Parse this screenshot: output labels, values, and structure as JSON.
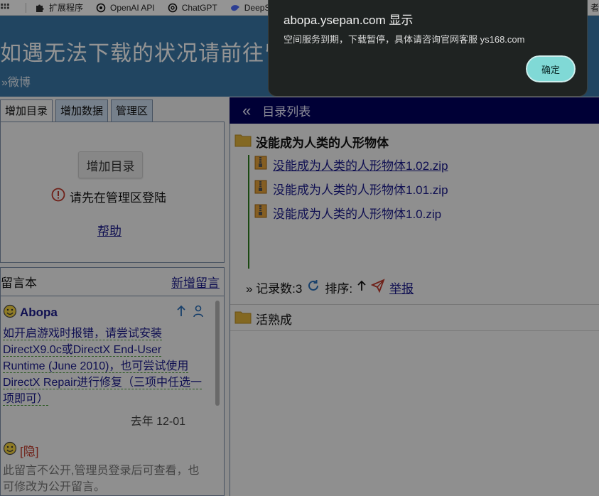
{
  "bookmarks": [
    {
      "label": "扩展程序",
      "icon": "puzzle-icon"
    },
    {
      "label": "OpenAI API",
      "icon": "openai-icon"
    },
    {
      "label": "ChatGPT",
      "icon": "openai-icon"
    },
    {
      "label": "DeepS",
      "icon": "deepseek-icon"
    },
    {
      "label": "者",
      "icon": ""
    }
  ],
  "banner": {
    "title": "如遇无法下载的状况请前往留言本留言，我们会在第一时间",
    "subtitle": "»微博"
  },
  "left_tabs": [
    "增加目录",
    "增加数据",
    "管理区"
  ],
  "add_panel": {
    "button_label": "增加目录",
    "login_tip": "请先在管理区登陆",
    "help_link": "帮助"
  },
  "guestbook": {
    "title": "留言本",
    "new_link": "新增留言",
    "messages": [
      {
        "author": "Abopa",
        "text": "如开启游戏时报错，请尝试安装DirectX9.0c或DirectX End-User Runtime (June 2010)，也可尝试使用DirectX Repair进行修复（三项中任选一项即可）",
        "date": "去年 12-01"
      },
      {
        "author": "[隐]",
        "text": "此留言不公开,管理员登录后可查看，也可修改为公开留言。"
      }
    ]
  },
  "directory": {
    "header": "目录列表",
    "folder1": "没能成为人类的人形物体",
    "files": [
      "没能成为人类的人形物体1.02.zip",
      "没能成为人类的人形物体1.01.zip",
      "没能成为人类的人形物体1.0.zip"
    ],
    "record_count": "» 记录数:3",
    "sort_label": "排序:",
    "report_label": "举报",
    "folder2": "活熟成"
  },
  "dialog": {
    "title": "abopa.ysepan.com 显示",
    "message": "空间服务到期，下载暂停，具体请咨询官网客服 ys168.com",
    "ok_label": "确定"
  },
  "colors": {
    "banner_bg": "#3a78a8",
    "dir_header_bg": "#00005e",
    "dialog_bg": "#1f2322",
    "ok_button": "#80d9d6",
    "link": "#1a1a8c"
  }
}
